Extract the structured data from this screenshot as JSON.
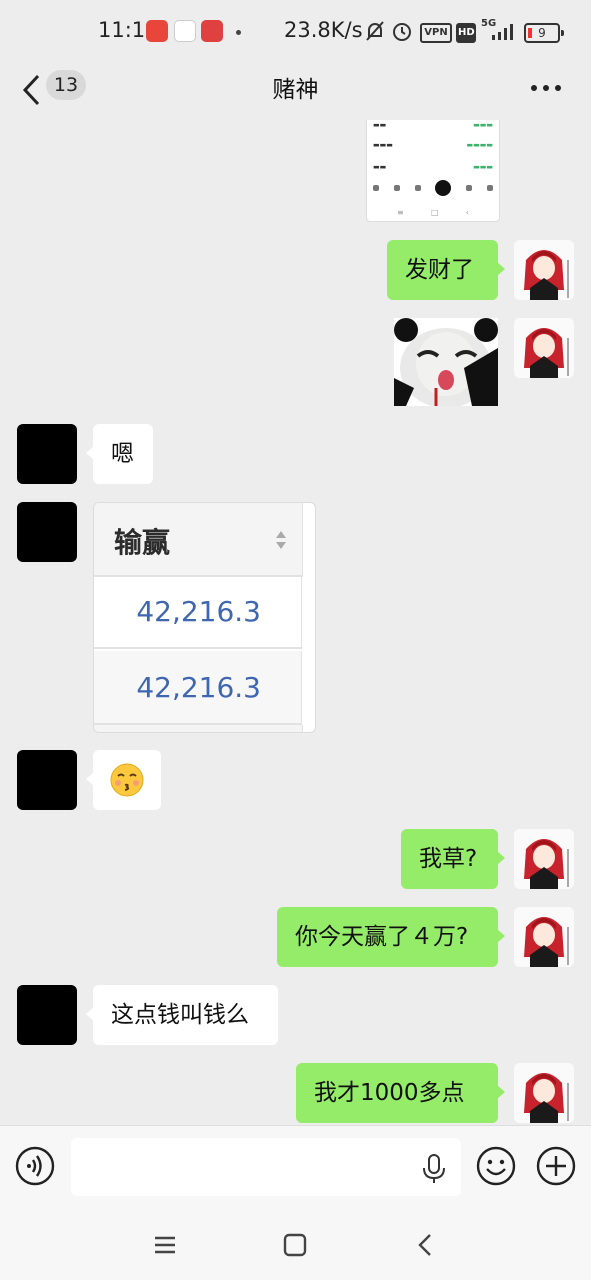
{
  "status_bar": {
    "time": "11:15",
    "network_speed": "23.8K/s",
    "vpn_label": "VPN",
    "hd_label": "HD",
    "signal_label": "5G",
    "battery_level": "9"
  },
  "header": {
    "unread_count": "13",
    "title": "赌神"
  },
  "messages": [
    {
      "side": "me",
      "kind": "screenshot"
    },
    {
      "side": "me",
      "kind": "text",
      "text": "发财了"
    },
    {
      "side": "me",
      "kind": "sticker",
      "sticker": "panda-meme"
    },
    {
      "side": "them",
      "kind": "text",
      "text": "嗯"
    },
    {
      "side": "them",
      "kind": "table-image",
      "header": "输赢",
      "rows": [
        "42,216.3",
        "42,216.3"
      ]
    },
    {
      "side": "them",
      "kind": "emoji",
      "emoji": "😚"
    },
    {
      "side": "me",
      "kind": "text",
      "text": "我草?"
    },
    {
      "side": "me",
      "kind": "text",
      "text": "你今天赢了４万?"
    },
    {
      "side": "them",
      "kind": "text",
      "text": "这点钱叫钱么"
    },
    {
      "side": "me",
      "kind": "text",
      "text": "我才1000多点"
    }
  ],
  "colors": {
    "my_bubble": "#95ec69",
    "their_bubble": "#ffffff",
    "chat_background": "#ededed"
  },
  "input_bar": {
    "icons": [
      "voice-icon",
      "mic-icon",
      "emoji-icon",
      "plus-icon"
    ]
  },
  "nav_bar": {
    "icons": [
      "menu-icon",
      "home-icon",
      "back-icon"
    ]
  }
}
